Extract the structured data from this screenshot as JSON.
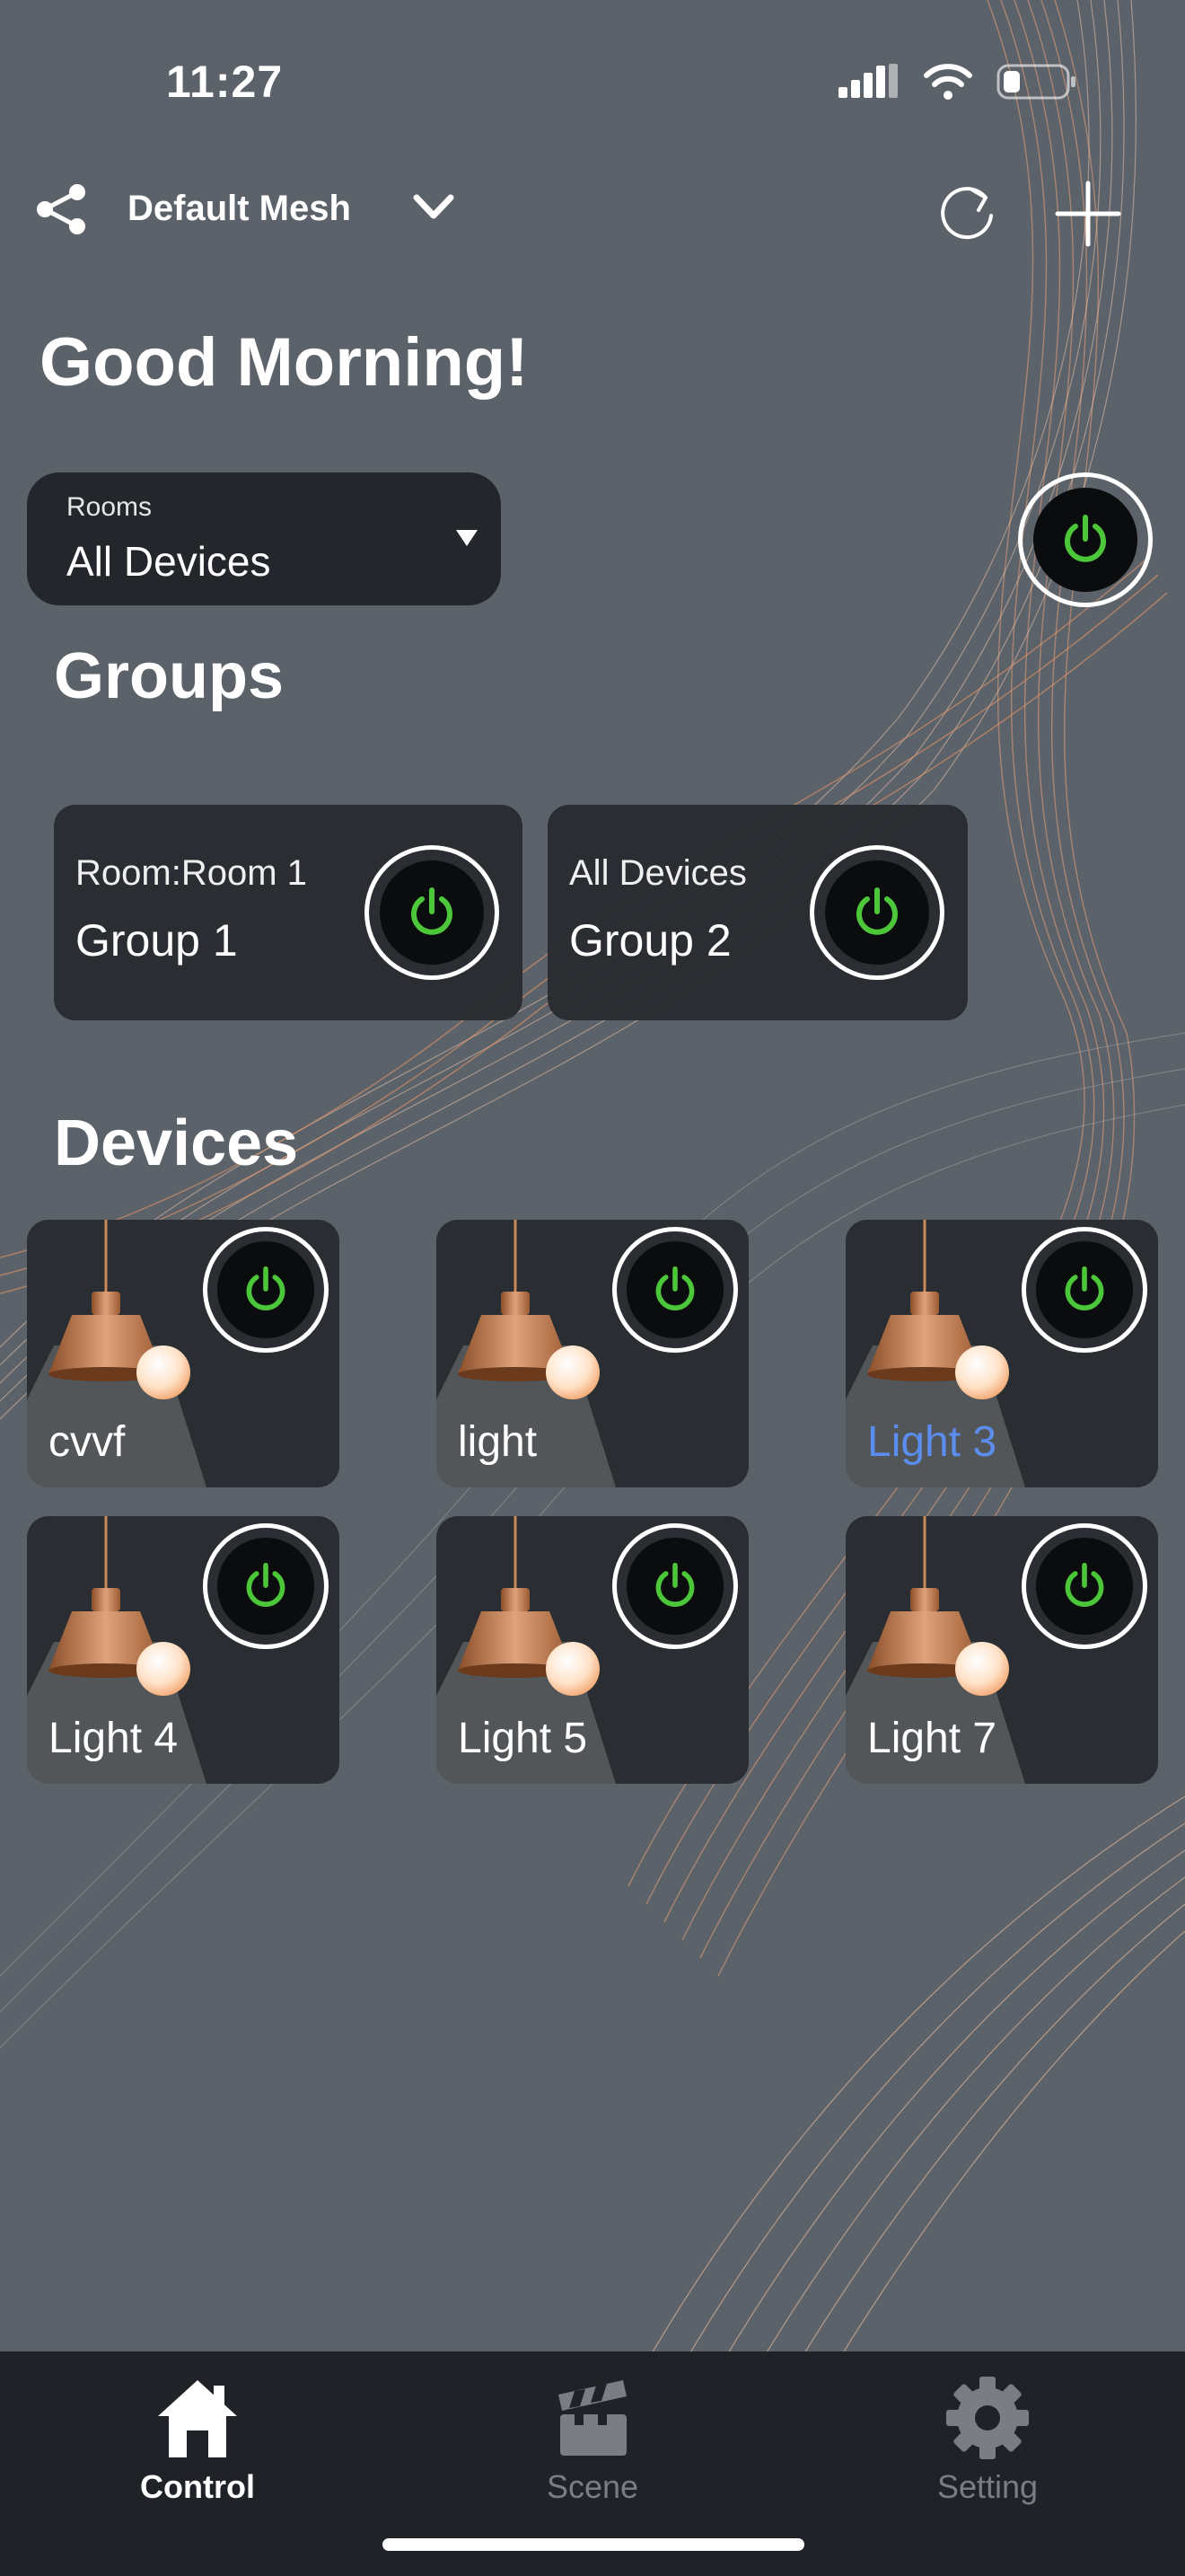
{
  "status_bar": {
    "time": "11:27"
  },
  "header": {
    "mesh_name": "Default Mesh"
  },
  "greeting": "Good Morning!",
  "rooms": {
    "caption": "Rooms",
    "selected": "All Devices"
  },
  "groups_title": "Groups",
  "groups": [
    {
      "room": "Room:Room 1",
      "name": "Group 1"
    },
    {
      "room": "All Devices",
      "name": "Group 2"
    }
  ],
  "devices_title": "Devices",
  "devices": [
    {
      "name": "cvvf",
      "active": false
    },
    {
      "name": "light",
      "active": false
    },
    {
      "name": "Light 3",
      "active": true
    },
    {
      "name": "Light 4",
      "active": false
    },
    {
      "name": "Light 5",
      "active": false
    },
    {
      "name": "Light 7",
      "active": false
    }
  ],
  "tabs": [
    {
      "label": "Control",
      "icon": "home-icon",
      "active": true
    },
    {
      "label": "Scene",
      "icon": "clapperboard-icon",
      "active": false
    },
    {
      "label": "Setting",
      "icon": "gear-icon",
      "active": false
    }
  ],
  "colors": {
    "background": "#5c6269",
    "card": "#2a2d31",
    "power_green": "#4cc73a",
    "accent_blue": "#5b8def",
    "wave_orange": "#e08a55"
  }
}
